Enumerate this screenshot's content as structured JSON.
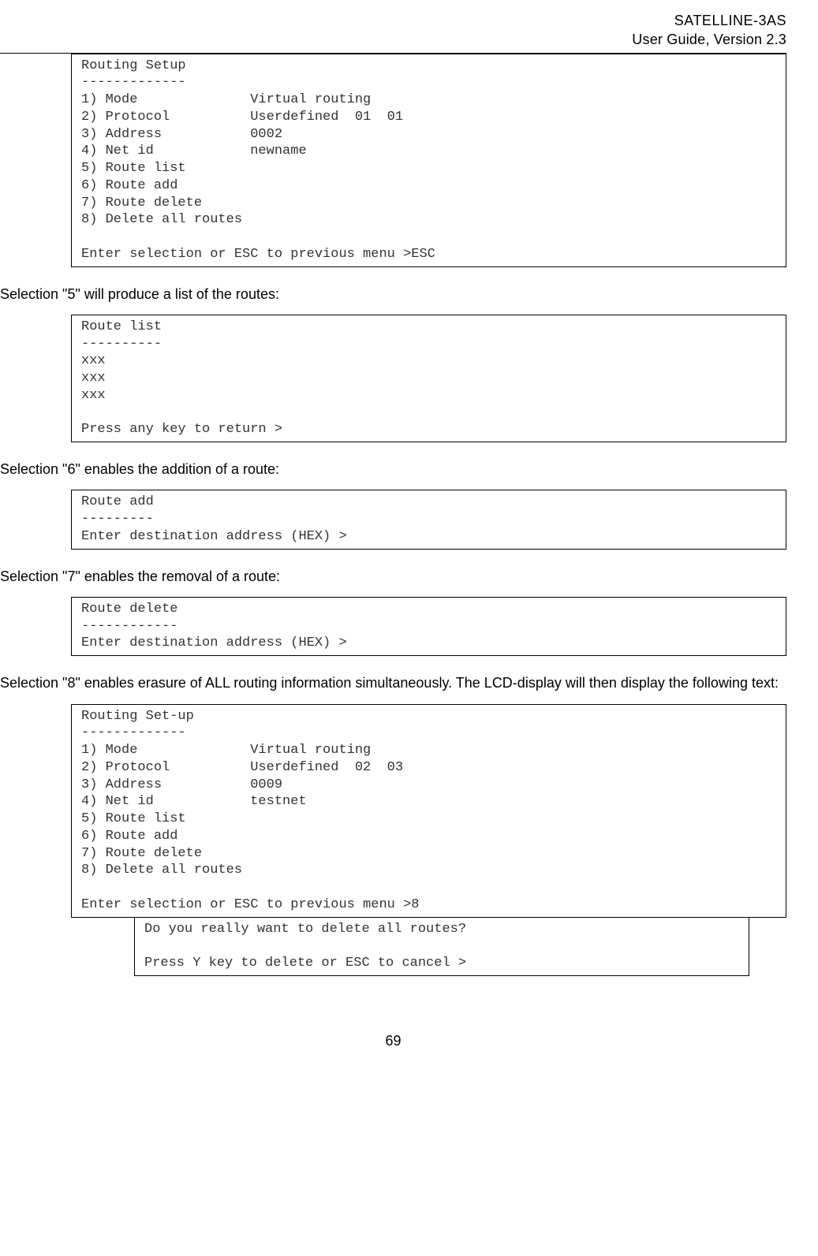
{
  "header": {
    "line1": "SATELLINE-3AS",
    "line2": "User Guide, Version 2.3"
  },
  "terminal1": "Routing Setup\n-------------\n1) Mode              Virtual routing\n2) Protocol          Userdefined  01  01\n3) Address           0002\n4) Net id            newname\n5) Route list\n6) Route add\n7) Route delete\n8) Delete all routes\n\nEnter selection or ESC to previous menu >ESC",
  "para1": "Selection \"5\" will produce a list of the routes:",
  "terminal2": "Route list\n----------\nxxx\nxxx\nxxx\n\nPress any key to return >",
  "para2": "Selection \"6\" enables the addition of a route:",
  "terminal3": "Route add\n---------\nEnter destination address (HEX) >",
  "para3": "Selection \"7\" enables the removal of a route:",
  "terminal4": "Route delete\n------------\nEnter destination address (HEX) >",
  "para4": "Selection \"8\" enables erasure of ALL routing information simultaneously. The LCD-display will then display the following text:",
  "terminal5": "Routing Set-up\n-------------\n1) Mode              Virtual routing\n2) Protocol          Userdefined  02  03\n3) Address           0009\n4) Net id            testnet\n5) Route list\n6) Route add\n7) Route delete\n8) Delete all routes\n\nEnter selection or ESC to previous menu >8",
  "confirm": "Do you really want to delete all routes?\n\nPress Y key to delete or ESC to cancel >",
  "pageNumber": "69"
}
